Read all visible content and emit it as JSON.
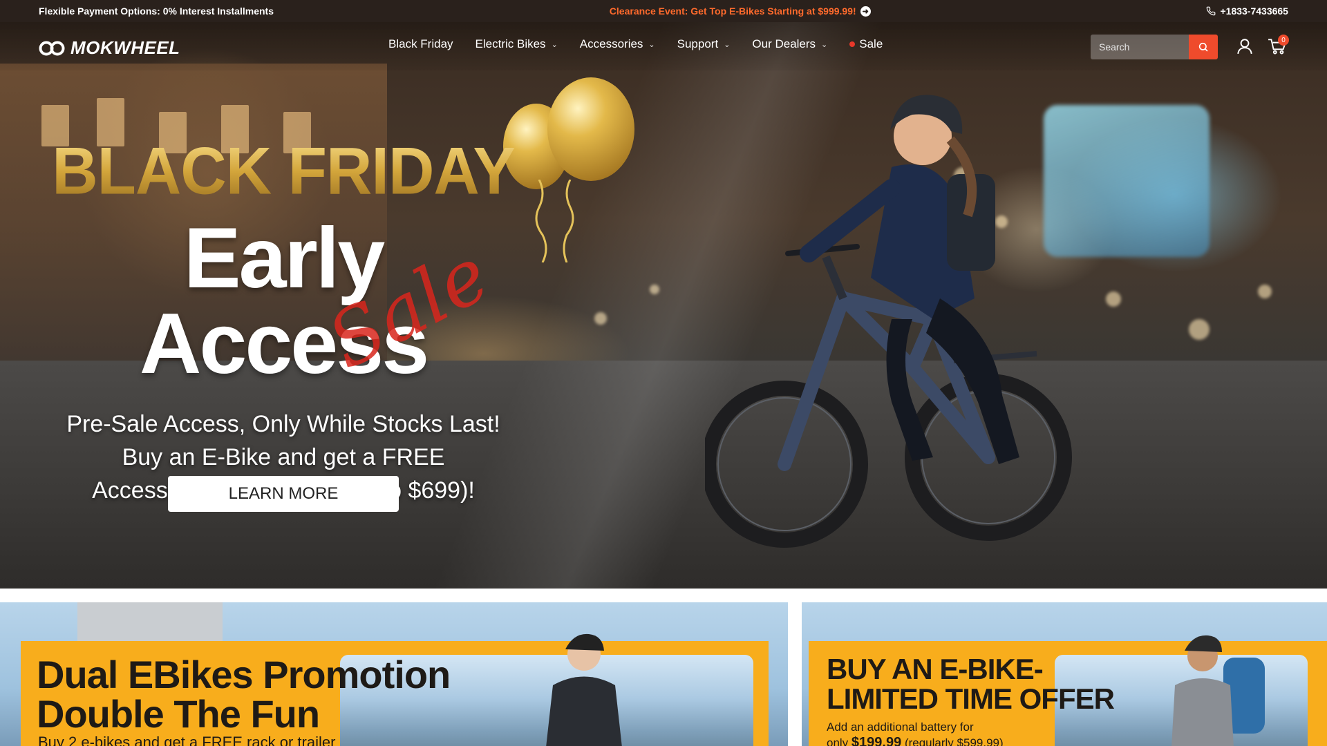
{
  "topbar": {
    "left_text": "Flexible Payment Options: 0% Interest Installments",
    "center_text": "Clearance Event: Get Top E-Bikes Starting at $999.99!",
    "phone": "+1833-7433665"
  },
  "header": {
    "logo_text": "MOKWHEEL",
    "menu": [
      {
        "label": "Black Friday"
      },
      {
        "label": "Electric Bikes"
      },
      {
        "label": "Accessories"
      },
      {
        "label": "Support"
      },
      {
        "label": "Our Dealers"
      },
      {
        "label": "Sale"
      }
    ],
    "search": {
      "placeholder": "Search"
    },
    "cart_count": "0"
  },
  "hero": {
    "title": "BLACK FRIDAY",
    "headline": "Early Access",
    "script_word": "Sale",
    "subtitle_lines": [
      "Pre-Sale Access, Only While Stocks Last!",
      "Buy an E-Bike and get a FREE",
      "Accessory Pack (valued up to $699)!"
    ],
    "cta_label": "LEARN MORE"
  },
  "promos": [
    {
      "title_lines": [
        "Dual EBikes Promotion",
        "Double The Fun"
      ],
      "description": "Buy 2 e-bikes and get a FREE rack or trailer"
    },
    {
      "title_lines": [
        "BUY AN E-BIKE-",
        "LIMITED TIME OFFER"
      ],
      "description_line1": "Add an additional battery for",
      "description_prefix": "only ",
      "price": "$199.99",
      "regular": "(regularly $599.99)"
    }
  ],
  "colors": {
    "topbar_bg": "#2a211c",
    "accent_orange": "#ff6a2c",
    "search_button": "#ef4b2c",
    "promo_yellow": "#f8ad1c",
    "gold": "#d9b04a",
    "script_red": "#d9261d"
  },
  "icons": {
    "phone": "phone-icon",
    "arrow": "arrow-right-circle-icon",
    "search": "search-icon",
    "account": "user-icon",
    "cart": "cart-icon",
    "chevron": "chevron-down-icon"
  }
}
